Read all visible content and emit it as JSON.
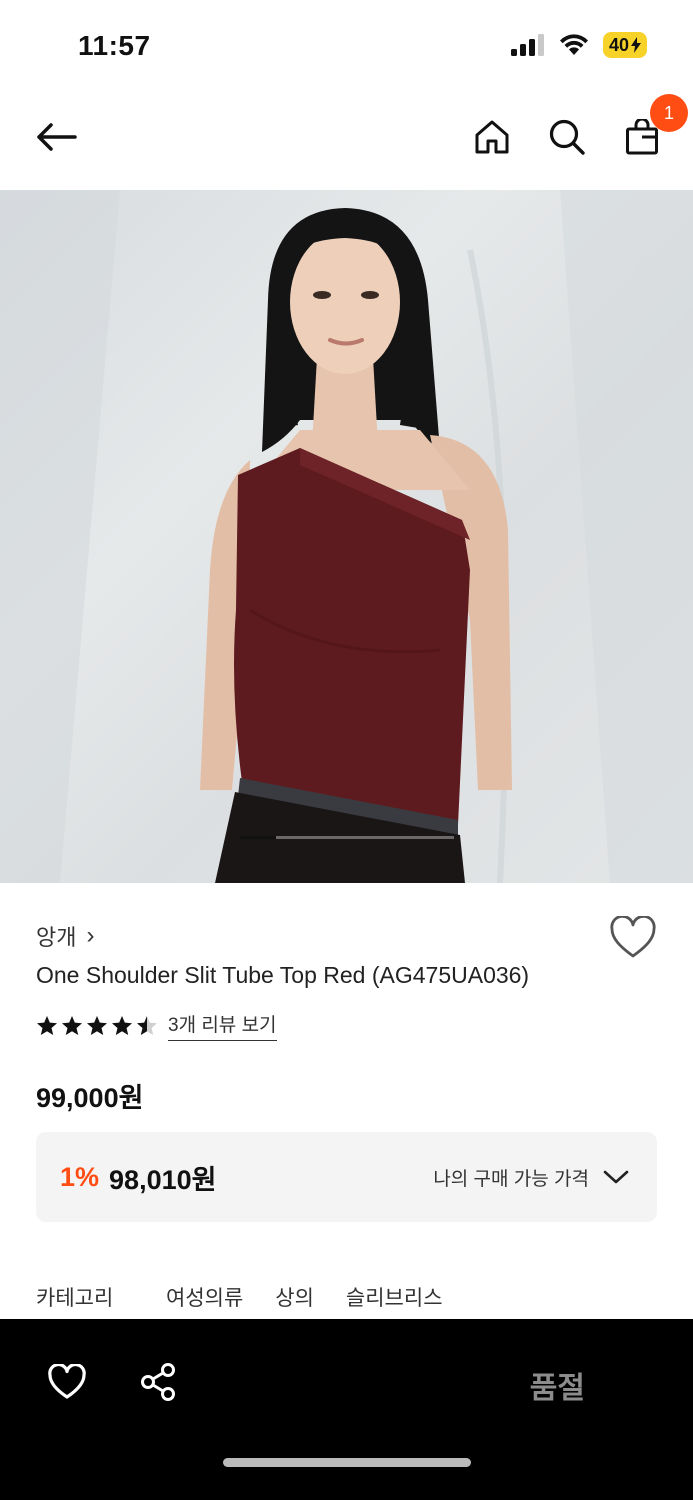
{
  "status": {
    "time": "11:57",
    "battery": "40"
  },
  "nav": {
    "cart_count": "1"
  },
  "hero": {
    "slide_progress": 0.17
  },
  "product": {
    "brand": "앙개",
    "brand_chevron": "›",
    "name": "One Shoulder Slit Tube Top Red (AG475UA036)",
    "rating": 4.5,
    "review_link": "3개 리뷰 보기",
    "price": "99,000원"
  },
  "price_box": {
    "discount": "1%",
    "member_price": "98,010원",
    "my_price_label": "나의 구매 가능 가격"
  },
  "category": {
    "label": "카테고리",
    "items": [
      "여성의류",
      "상의",
      "슬리브리스"
    ]
  },
  "bottom_bar": {
    "soldout_label": "품절"
  },
  "colors": {
    "accent": "#ff4d14",
    "product_red": "#5e1b1f",
    "bar_bg": "#000000"
  },
  "icons": [
    "back-arrow-icon",
    "home-icon",
    "search-icon",
    "shopping-bag-icon",
    "heart-icon",
    "share-icon",
    "chevron-down-icon",
    "star-icon"
  ]
}
